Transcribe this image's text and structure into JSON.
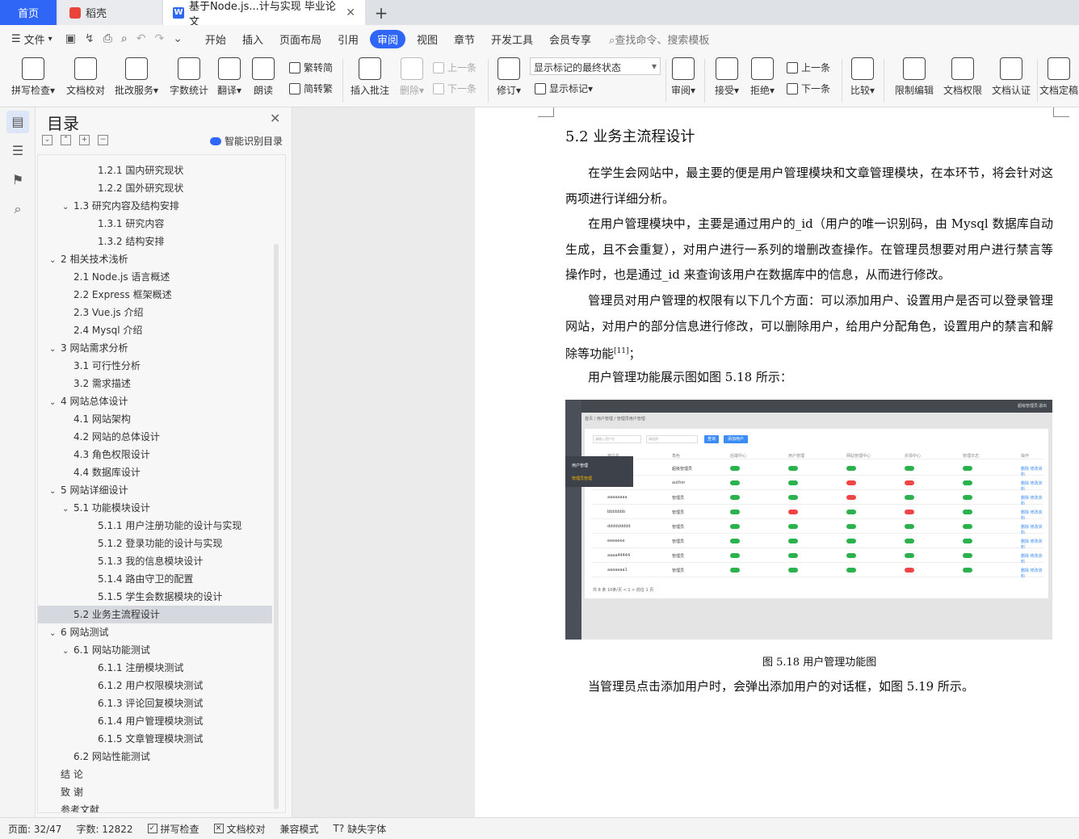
{
  "tabs": {
    "home": "首页",
    "daoke": "稻壳",
    "doc": "基于Node.js...计与实现 毕业论文",
    "close": "✕",
    "add": "+"
  },
  "menu": {
    "file": "文件",
    "items": [
      "开始",
      "插入",
      "页面布局",
      "引用",
      "审阅",
      "视图",
      "章节",
      "开发工具",
      "会员专享"
    ],
    "active_index": 4,
    "search": "查找命令、搜索模板"
  },
  "ribbon": {
    "spell": "拼写检查▾",
    "proofread": "文档校对",
    "review_service": "批改服务▾",
    "wordcount": "字数统计",
    "translate": "翻译▾",
    "read": "朗读",
    "to_traditional": "繁转简",
    "to_simplified": "简转繁",
    "insert_comment": "插入批注",
    "delete": "删除▾",
    "prev": "上一条",
    "next": "下一条",
    "revise": "修订▾",
    "show_mode": "显示标记的最终状态",
    "show_marks": "显示标记▾",
    "review": "审阅▾",
    "accept": "接受▾",
    "reject": "拒绝▾",
    "prev2": "上一条",
    "next2": "下一条",
    "compare": "比较▾",
    "restrict": "限制编辑",
    "rights": "文档权限",
    "cert": "文档认证",
    "finalize": "文档定稿"
  },
  "toc": {
    "title": "目录",
    "close": "✕",
    "smart": "智能识别目录",
    "items": [
      {
        "text": "1.2.1 国内研究现状",
        "level": 3,
        "arrow": ""
      },
      {
        "text": "1.2.2 国外研究现状",
        "level": 3,
        "arrow": ""
      },
      {
        "text": "1.3  研究内容及结构安排",
        "level": 2,
        "arrow": "⌄"
      },
      {
        "text": "1.3.1  研究内容",
        "level": 3,
        "arrow": ""
      },
      {
        "text": "1.3.2  结构安排",
        "level": 3,
        "arrow": ""
      },
      {
        "text": "2 相关技术浅析",
        "level": 1,
        "arrow": "⌄"
      },
      {
        "text": "2.1 Node.js 语言概述",
        "level": 2,
        "arrow": ""
      },
      {
        "text": "2.2 Express 框架概述",
        "level": 2,
        "arrow": ""
      },
      {
        "text": "2.3 Vue.js 介绍",
        "level": 2,
        "arrow": ""
      },
      {
        "text": "2.4 Mysql 介绍",
        "level": 2,
        "arrow": ""
      },
      {
        "text": "3 网站需求分析",
        "level": 1,
        "arrow": "⌄"
      },
      {
        "text": "3.1 可行性分析",
        "level": 2,
        "arrow": ""
      },
      {
        "text": "3.2 需求描述",
        "level": 2,
        "arrow": ""
      },
      {
        "text": "4 网站总体设计",
        "level": 1,
        "arrow": "⌄"
      },
      {
        "text": "4.1  网站架构",
        "level": 2,
        "arrow": ""
      },
      {
        "text": "4.2  网站的总体设计",
        "level": 2,
        "arrow": ""
      },
      {
        "text": "4.3  角色权限设计",
        "level": 2,
        "arrow": ""
      },
      {
        "text": "4.4  数据库设计",
        "level": 2,
        "arrow": ""
      },
      {
        "text": "5 网站详细设计",
        "level": 1,
        "arrow": "⌄"
      },
      {
        "text": "5.1  功能模块设计",
        "level": 2,
        "arrow": "⌄"
      },
      {
        "text": "5.1.1  用户注册功能的设计与实现",
        "level": 3,
        "arrow": ""
      },
      {
        "text": "5.1.2  登录功能的设计与实现",
        "level": 3,
        "arrow": ""
      },
      {
        "text": "5.1.3  我的信息模块设计",
        "level": 3,
        "arrow": ""
      },
      {
        "text": "5.1.4  路由守卫的配置",
        "level": 3,
        "arrow": ""
      },
      {
        "text": "5.1.5  学生会数据模块的设计",
        "level": 3,
        "arrow": ""
      },
      {
        "text": "5.2 业务主流程设计",
        "level": 2,
        "arrow": "",
        "selected": true
      },
      {
        "text": "6 网站测试",
        "level": 1,
        "arrow": "⌄"
      },
      {
        "text": "6.1  网站功能测试",
        "level": 2,
        "arrow": "⌄"
      },
      {
        "text": "6.1.1  注册模块测试",
        "level": 3,
        "arrow": ""
      },
      {
        "text": "6.1.2  用户权限模块测试",
        "level": 3,
        "arrow": ""
      },
      {
        "text": "6.1.3  评论回复模块测试",
        "level": 3,
        "arrow": ""
      },
      {
        "text": "6.1.4  用户管理模块测试",
        "level": 3,
        "arrow": ""
      },
      {
        "text": "6.1.5  文章管理模块测试",
        "level": 3,
        "arrow": ""
      },
      {
        "text": "6.2  网站性能测试",
        "level": 2,
        "arrow": ""
      },
      {
        "text": "结    论",
        "level": 1,
        "arrow": ""
      },
      {
        "text": "致    谢",
        "level": 1,
        "arrow": ""
      },
      {
        "text": "参考文献",
        "level": 1,
        "arrow": ""
      }
    ]
  },
  "doc": {
    "heading": "5.2 业务主流程设计",
    "p1": "在学生会网站中，最主要的便是用户管理模块和文章管理模块，在本环节，将会针对这两项进行详细分析。",
    "p2": "在用户管理模块中，主要是通过用户的_id（用户的唯一识别码，由 Mysql 数据库自动生成，且不会重复），对用户进行一系列的增删改查操作。在管理员想要对用户进行禁言等操作时，也是通过_id 来查询该用户在数据库中的信息，从而进行修改。",
    "p3": "管理员对用户管理的权限有以下几个方面：可以添加用户、设置用户是否可以登录管理网站，对用户的部分信息进行修改，可以删除用户，给用户分配角色，设置用户的禁言和解除等功能",
    "p3_ref": "[11]",
    "p3_end": "；",
    "p4": "用户管理功能展示图如图 5.18 所示：",
    "caption": "图 5.18 用户管理功能图",
    "p5": "当管理员点击添加用户时，会弹出添加用户的对话框，如图 5.19 所示。"
  },
  "figure": {
    "top_user": "超级管理员",
    "top_exit": "退出",
    "breadcrumb": "首页 / 用户管理 / 管理员用户管理",
    "search_placeholder": "请输入用户名",
    "select_placeholder": "请选择",
    "btn_query": "查询",
    "btn_add": "添加用户",
    "popup_1": "用户管理",
    "popup_2": "管理员管理",
    "columns": [
      "用户名",
      "角色",
      "后端中心",
      "用户管理",
      "网站管理中心",
      "反馈中心",
      "管理日志",
      "操作"
    ],
    "rows": [
      {
        "name": "",
        "role": "超级管理员",
        "t": [
          1,
          1,
          1,
          1,
          1
        ]
      },
      {
        "name": "",
        "role": "author",
        "t": [
          1,
          1,
          0,
          0,
          1
        ]
      },
      {
        "name": "aaaaaaaa",
        "role": "管理员",
        "t": [
          1,
          1,
          0,
          1,
          1
        ]
      },
      {
        "name": "bbbbbbb",
        "role": "管理员",
        "t": [
          1,
          0,
          1,
          0,
          1
        ]
      },
      {
        "name": "ddddddddd",
        "role": "管理员",
        "t": [
          1,
          1,
          1,
          1,
          1
        ]
      },
      {
        "name": "eeeeeee",
        "role": "管理员",
        "t": [
          1,
          1,
          1,
          1,
          1
        ]
      },
      {
        "name": "aaaa44444",
        "role": "管理员",
        "t": [
          1,
          1,
          1,
          1,
          1
        ]
      },
      {
        "name": "aaaaaaa1",
        "role": "管理员",
        "t": [
          1,
          1,
          1,
          0,
          1
        ]
      }
    ],
    "action": "删除  修改资料",
    "pager": "共 8 条   10条/页   <  1  >   前往  1  页"
  },
  "status": {
    "page": "页面: 32/47",
    "words": "字数: 12822",
    "spell": "拼写检查",
    "proof": "文档校对",
    "compat": "兼容模式",
    "missing_font": "缺失字体"
  },
  "colors": {
    "accent": "#2f66f6",
    "toggle_on": "#2bb24c",
    "toggle_off": "#f04545"
  }
}
